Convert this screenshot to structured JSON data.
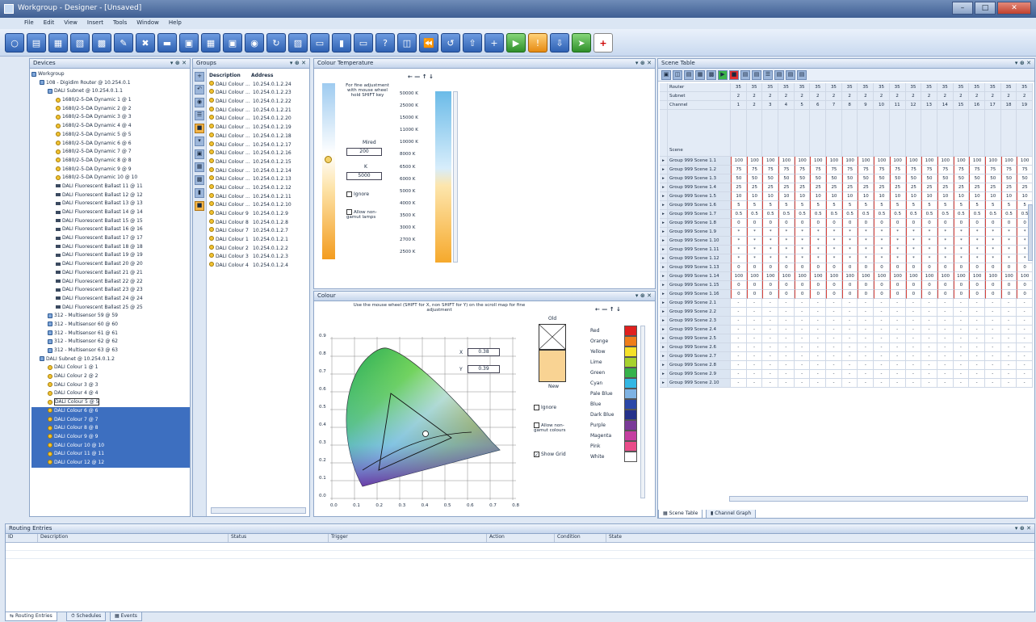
{
  "window": {
    "title": "Workgroup - Designer - [Unsaved]"
  },
  "menu": [
    "File",
    "Edit",
    "View",
    "Insert",
    "Tools",
    "Window",
    "Help"
  ],
  "panels": {
    "devices": "Devices",
    "groups": "Groups",
    "colour_temp": "Colour Temperature",
    "colour": "Colour",
    "scene_table": "Scene Table",
    "routing": "Routing Entries"
  },
  "devices": [
    {
      "t": "Workgroup",
      "ind": 0,
      "k": "root"
    },
    {
      "t": "108 - Digidim Router @ 10.254.0.1",
      "ind": 1,
      "k": "router"
    },
    {
      "t": "DALI Subnet @ 10.254.0.1.1",
      "ind": 2,
      "k": "subnet"
    },
    {
      "t": "1680/2-5-DA Dynamic 1 @ 1",
      "ind": 3,
      "k": "dyn"
    },
    {
      "t": "1680/2-5-DA Dynamic 2 @ 2",
      "ind": 3,
      "k": "dyn"
    },
    {
      "t": "1680/2-5-DA Dynamic 3 @ 3",
      "ind": 3,
      "k": "dyn"
    },
    {
      "t": "1680/2-5-DA Dynamic 4 @ 4",
      "ind": 3,
      "k": "dyn"
    },
    {
      "t": "1680/2-5-DA Dynamic 5 @ 5",
      "ind": 3,
      "k": "dyn"
    },
    {
      "t": "1680/2-5-DA Dynamic 6 @ 6",
      "ind": 3,
      "k": "dyn"
    },
    {
      "t": "1680/2-5-DA Dynamic 7 @ 7",
      "ind": 3,
      "k": "dyn"
    },
    {
      "t": "1680/2-5-DA Dynamic 8 @ 8",
      "ind": 3,
      "k": "dyn"
    },
    {
      "t": "1680/2-5-DA Dynamic 9 @ 9",
      "ind": 3,
      "k": "dyn"
    },
    {
      "t": "1680/2-5-DA Dynamic 10 @ 10",
      "ind": 3,
      "k": "dyn"
    },
    {
      "t": "DALI Fluorescent Ballast 11 @ 11",
      "ind": 3,
      "k": "lamp"
    },
    {
      "t": "DALI Fluorescent Ballast 12 @ 12",
      "ind": 3,
      "k": "lamp"
    },
    {
      "t": "DALI Fluorescent Ballast 13 @ 13",
      "ind": 3,
      "k": "lamp"
    },
    {
      "t": "DALI Fluorescent Ballast 14 @ 14",
      "ind": 3,
      "k": "lamp"
    },
    {
      "t": "DALI Fluorescent Ballast 15 @ 15",
      "ind": 3,
      "k": "lamp"
    },
    {
      "t": "DALI Fluorescent Ballast 16 @ 16",
      "ind": 3,
      "k": "lamp"
    },
    {
      "t": "DALI Fluorescent Ballast 17 @ 17",
      "ind": 3,
      "k": "lamp"
    },
    {
      "t": "DALI Fluorescent Ballast 18 @ 18",
      "ind": 3,
      "k": "lamp"
    },
    {
      "t": "DALI Fluorescent Ballast 19 @ 19",
      "ind": 3,
      "k": "lamp"
    },
    {
      "t": "DALI Fluorescent Ballast 20 @ 20",
      "ind": 3,
      "k": "lamp"
    },
    {
      "t": "DALI Fluorescent Ballast 21 @ 21",
      "ind": 3,
      "k": "lamp"
    },
    {
      "t": "DALI Fluorescent Ballast 22 @ 22",
      "ind": 3,
      "k": "lamp"
    },
    {
      "t": "DALI Fluorescent Ballast 23 @ 23",
      "ind": 3,
      "k": "lamp"
    },
    {
      "t": "DALI Fluorescent Ballast 24 @ 24",
      "ind": 3,
      "k": "lamp"
    },
    {
      "t": "DALI Fluorescent Ballast 25 @ 25",
      "ind": 3,
      "k": "lamp"
    },
    {
      "t": "312 - Multisensor 59 @ 59",
      "ind": 2,
      "k": "sensor"
    },
    {
      "t": "312 - Multisensor 60 @ 60",
      "ind": 2,
      "k": "sensor"
    },
    {
      "t": "312 - Multisensor 61 @ 61",
      "ind": 2,
      "k": "sensor"
    },
    {
      "t": "312 - Multisensor 62 @ 62",
      "ind": 2,
      "k": "sensor"
    },
    {
      "t": "312 - Multisensor 63 @ 63",
      "ind": 2,
      "k": "sensor"
    },
    {
      "t": "DALI Subnet @ 10.254.0.1.2",
      "ind": 1,
      "k": "subnet"
    },
    {
      "t": "DALI Colour 1 @ 1",
      "ind": 2,
      "k": "col"
    },
    {
      "t": "DALI Colour 2 @ 2",
      "ind": 2,
      "k": "col"
    },
    {
      "t": "DALI Colour 3 @ 3",
      "ind": 2,
      "k": "col"
    },
    {
      "t": "DALI Colour 4 @ 4",
      "ind": 2,
      "k": "col"
    },
    {
      "t": "DALI Colour 5 @ 5",
      "ind": 2,
      "k": "col",
      "box": true
    },
    {
      "t": "DALI Colour 6 @ 6",
      "ind": 2,
      "k": "col",
      "sel": true
    },
    {
      "t": "DALI Colour 7 @ 7",
      "ind": 2,
      "k": "col",
      "sel": true
    },
    {
      "t": "DALI Colour 8 @ 8",
      "ind": 2,
      "k": "col",
      "sel": true
    },
    {
      "t": "DALI Colour 9 @ 9",
      "ind": 2,
      "k": "col",
      "sel": true
    },
    {
      "t": "DALI Colour 10 @ 10",
      "ind": 2,
      "k": "col",
      "sel": true
    },
    {
      "t": "DALI Colour 11 @ 11",
      "ind": 2,
      "k": "col",
      "sel": true
    },
    {
      "t": "DALI Colour 12 @ 12",
      "ind": 2,
      "k": "col",
      "sel": true
    }
  ],
  "groups": {
    "headers": [
      "Description",
      "Address"
    ],
    "rows": [
      [
        "DALI Colour ...",
        "10.254.0.1.2.24"
      ],
      [
        "DALI Colour ...",
        "10.254.0.1.2.23"
      ],
      [
        "DALI Colour ...",
        "10.254.0.1.2.22"
      ],
      [
        "DALI Colour ...",
        "10.254.0.1.2.21"
      ],
      [
        "DALI Colour ...",
        "10.254.0.1.2.20"
      ],
      [
        "DALI Colour ...",
        "10.254.0.1.2.19"
      ],
      [
        "DALI Colour ...",
        "10.254.0.1.2.18"
      ],
      [
        "DALI Colour ...",
        "10.254.0.1.2.17"
      ],
      [
        "DALI Colour ...",
        "10.254.0.1.2.16"
      ],
      [
        "DALI Colour ...",
        "10.254.0.1.2.15"
      ],
      [
        "DALI Colour ...",
        "10.254.0.1.2.14"
      ],
      [
        "DALI Colour ...",
        "10.254.0.1.2.13"
      ],
      [
        "DALI Colour ...",
        "10.254.0.1.2.12"
      ],
      [
        "DALI Colour ...",
        "10.254.0.1.2.11"
      ],
      [
        "DALI Colour ...",
        "10.254.0.1.2.10"
      ],
      [
        "DALI Colour 9",
        "10.254.0.1.2.9"
      ],
      [
        "DALI Colour 8",
        "10.254.0.1.2.8"
      ],
      [
        "DALI Colour 7",
        "10.254.0.1.2.7"
      ],
      [
        "DALI Colour 1",
        "10.254.0.1.2.1"
      ],
      [
        "DALI Colour 2",
        "10.254.0.1.2.2"
      ],
      [
        "DALI Colour 3",
        "10.254.0.1.2.3"
      ],
      [
        "DALI Colour 4",
        "10.254.0.1.2.4"
      ]
    ]
  },
  "ctemp": {
    "hint": "For fine adjustment with mouse wheel hold SHIFT key",
    "mired_label": "Mired",
    "mired": "200",
    "k_label": "K",
    "k": "5000",
    "ignore": "Ignore",
    "allow": "Allow non-gamut lamps",
    "scale": [
      "50000 K",
      "25000 K",
      "15000 K",
      "11000 K",
      "10000 K",
      "8000 K",
      "6500 K",
      "6000 K",
      "5000 K",
      "4000 K",
      "3500 K",
      "3000 K",
      "2700 K",
      "2500 K"
    ],
    "arrows": "← — ↑ ↓"
  },
  "colour": {
    "hint": "Use the mouse wheel (SHIFT for X, non SHIFT for Y) on the scroll map for fine adjustment",
    "x_label": "X",
    "x": "0.38",
    "y_label": "Y",
    "y": "0.39",
    "old": "Old",
    "new": "New",
    "ignore": "Ignore",
    "allow": "Allow non-gamut colours",
    "grid": "Show Grid",
    "yticks": [
      "0.9",
      "0.8",
      "0.7",
      "0.6",
      "0.5",
      "0.4",
      "0.3",
      "0.2",
      "0.1",
      "0.0"
    ],
    "xticks": [
      "0.0",
      "0.1",
      "0.2",
      "0.3",
      "0.4",
      "0.5",
      "0.6",
      "0.7",
      "0.8"
    ],
    "swatches": [
      {
        "n": "Red",
        "c": "#e0201e"
      },
      {
        "n": "Orange",
        "c": "#ef7d1a"
      },
      {
        "n": "Yellow",
        "c": "#f5e12a"
      },
      {
        "n": "Lime",
        "c": "#a7d22e"
      },
      {
        "n": "Green",
        "c": "#36b24a"
      },
      {
        "n": "Cyan",
        "c": "#33b7e3"
      },
      {
        "n": "Pale Blue",
        "c": "#7fb3e3"
      },
      {
        "n": "Blue",
        "c": "#2b47a8"
      },
      {
        "n": "Dark Blue",
        "c": "#25318a"
      },
      {
        "n": "Purple",
        "c": "#7a3a98"
      },
      {
        "n": "Magenta",
        "c": "#c53fa0"
      },
      {
        "n": "Pink",
        "c": "#ea4c89"
      },
      {
        "n": "White",
        "c": "#ffffff"
      }
    ]
  },
  "scene": {
    "row_labels": [
      "Router",
      "Subnet",
      "Channel"
    ],
    "scene_label": "Scene",
    "router": "35",
    "subnet": "2",
    "channels": [
      "1",
      "2",
      "3",
      "4",
      "5",
      "6",
      "7",
      "8",
      "9",
      "10",
      "11",
      "12",
      "13",
      "14",
      "15",
      "16",
      "17",
      "18",
      "19"
    ],
    "rows": [
      {
        "n": "Group 999 Scene 1.1",
        "v": "100"
      },
      {
        "n": "Group 999 Scene 1.2",
        "v": "75"
      },
      {
        "n": "Group 999 Scene 1.3",
        "v": "50"
      },
      {
        "n": "Group 999 Scene 1.4",
        "v": "25"
      },
      {
        "n": "Group 999 Scene 1.5",
        "v": "10"
      },
      {
        "n": "Group 999 Scene 1.6",
        "v": "5"
      },
      {
        "n": "Group 999 Scene 1.7",
        "v": "0.5"
      },
      {
        "n": "Group 999 Scene 1.8",
        "v": "0"
      },
      {
        "n": "Group 999 Scene 1.9",
        "v": "*"
      },
      {
        "n": "Group 999 Scene 1.10",
        "v": "*"
      },
      {
        "n": "Group 999 Scene 1.11",
        "v": "*"
      },
      {
        "n": "Group 999 Scene 1.12",
        "v": "*"
      },
      {
        "n": "Group 999 Scene 1.13",
        "v": "0"
      },
      {
        "n": "Group 999 Scene 1.14",
        "v": "100"
      },
      {
        "n": "Group 999 Scene 1.15",
        "v": "0"
      },
      {
        "n": "Group 999 Scene 1.16",
        "v": "0"
      },
      {
        "n": "Group 999 Scene 2.1",
        "v": "-"
      },
      {
        "n": "Group 999 Scene 2.2",
        "v": "-"
      },
      {
        "n": "Group 999 Scene 2.3",
        "v": "-"
      },
      {
        "n": "Group 999 Scene 2.4",
        "v": "-"
      },
      {
        "n": "Group 999 Scene 2.5",
        "v": "-"
      },
      {
        "n": "Group 999 Scene 2.6",
        "v": "-"
      },
      {
        "n": "Group 999 Scene 2.7",
        "v": "-"
      },
      {
        "n": "Group 999 Scene 2.8",
        "v": "-"
      },
      {
        "n": "Group 999 Scene 2.9",
        "v": "-"
      },
      {
        "n": "Group 999 Scene 2.10",
        "v": "-"
      }
    ],
    "tabs": [
      "Scene Table",
      "Channel Graph"
    ]
  },
  "routing": {
    "headers": [
      "ID",
      "Description",
      "Status",
      "Trigger",
      "Action",
      "Condition",
      "State"
    ]
  },
  "bottom_tabs": [
    "Routing Entries",
    "Schedules",
    "Events"
  ]
}
